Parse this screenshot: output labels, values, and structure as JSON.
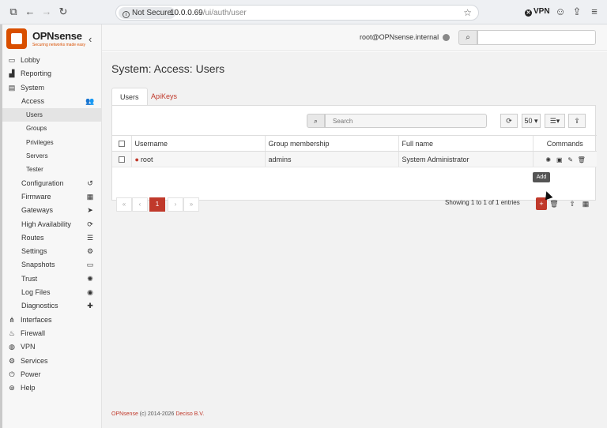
{
  "browser": {
    "not_secure": "Not Secure",
    "url_host": "10.0.0.69",
    "url_path": "/ui/auth/user",
    "vpn": "VPN"
  },
  "logo": {
    "name": "OPNsense",
    "tagline": "Securing networks made easy"
  },
  "topbar": {
    "hostname": "root@OPNsense.internal",
    "search_value": ""
  },
  "menu": [
    {
      "label": "Lobby",
      "icon": "laptop-icon"
    },
    {
      "label": "Reporting",
      "icon": "chart-icon"
    },
    {
      "label": "System",
      "icon": "server-icon"
    },
    {
      "label": "Access",
      "icon": "users-icon"
    },
    {
      "label": "Users"
    },
    {
      "label": "Groups"
    },
    {
      "label": "Privileges"
    },
    {
      "label": "Servers"
    },
    {
      "label": "Tester"
    },
    {
      "label": "Configuration",
      "icon": "history-icon"
    },
    {
      "label": "Firmware",
      "icon": "building-icon"
    },
    {
      "label": "Gateways",
      "icon": "location-arrow-icon"
    },
    {
      "label": "High Availability",
      "icon": "refresh-icon"
    },
    {
      "label": "Routes",
      "icon": "signpost-icon"
    },
    {
      "label": "Settings",
      "icon": "cogs-icon"
    },
    {
      "label": "Snapshots",
      "icon": "hdd-icon"
    },
    {
      "label": "Trust",
      "icon": "certificate-icon"
    },
    {
      "label": "Log Files",
      "icon": "eye-icon"
    },
    {
      "label": "Diagnostics",
      "icon": "medkit-icon"
    },
    {
      "label": "Interfaces",
      "icon": "sitemap-icon"
    },
    {
      "label": "Firewall",
      "icon": "fire-icon"
    },
    {
      "label": "VPN",
      "icon": "globe-icon"
    },
    {
      "label": "Services",
      "icon": "cog-icon"
    },
    {
      "label": "Power",
      "icon": "plug-icon"
    },
    {
      "label": "Help",
      "icon": "support-icon"
    }
  ],
  "page": {
    "title": "System: Access: Users",
    "tabs": [
      "Users",
      "ApiKeys"
    ],
    "search_placeholder": "Search",
    "page_size": "50",
    "columns": [
      "Username",
      "Group membership",
      "Full name",
      "Commands"
    ],
    "rows": [
      {
        "username": "root",
        "groups": "admins",
        "fullname": "System Administrator"
      }
    ],
    "pagination": {
      "first": "«",
      "prev": "‹",
      "current": "1",
      "next": "›",
      "last": "»"
    },
    "showing": "Showing 1 to 1 of 1 entries",
    "tooltip": "Add"
  },
  "footer": {
    "brand": "OPNsense",
    "copy": " (c) 2014-2026 ",
    "company": "Deciso B.V."
  },
  "colors": {
    "accent": "#d94f00",
    "brand_red": "#c0392b"
  }
}
